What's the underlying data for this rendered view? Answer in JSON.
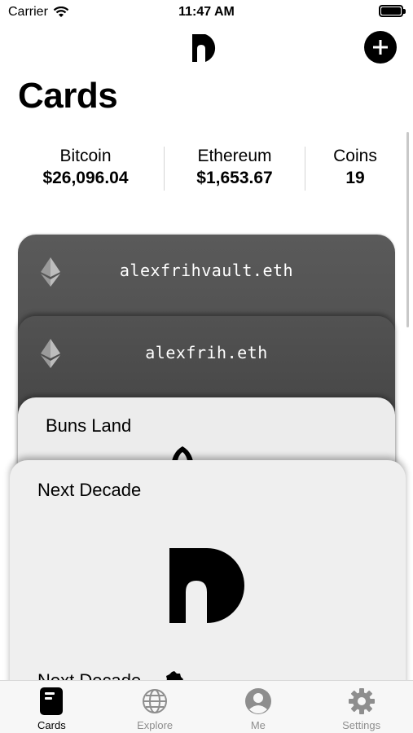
{
  "status_bar": {
    "carrier": "Carrier",
    "time": "11:47 AM"
  },
  "header": {
    "title": "Cards"
  },
  "stats": [
    {
      "label": "Bitcoin",
      "value": "$26,096.04"
    },
    {
      "label": "Ethereum",
      "value": "$1,653.67"
    },
    {
      "label": "Coins",
      "value": "19"
    }
  ],
  "cards": [
    {
      "name": "alexfrihvault.eth",
      "icon": "ethereum-icon"
    },
    {
      "name": "alexfrih.eth",
      "icon": "ethereum-icon"
    },
    {
      "name": "Buns Land"
    },
    {
      "name": "Next Decade",
      "footer": "Next Decade"
    }
  ],
  "tabs": [
    {
      "label": "Cards",
      "icon": "cards-icon",
      "active": true
    },
    {
      "label": "Explore",
      "icon": "globe-icon",
      "active": false
    },
    {
      "label": "Me",
      "icon": "person-icon",
      "active": false
    },
    {
      "label": "Settings",
      "icon": "gear-icon",
      "active": false
    }
  ],
  "colors": {
    "accent": "#000000",
    "inactive_tab": "#8e8e8e",
    "dark_card": "#4a4a4a",
    "light_card": "#ececec"
  }
}
